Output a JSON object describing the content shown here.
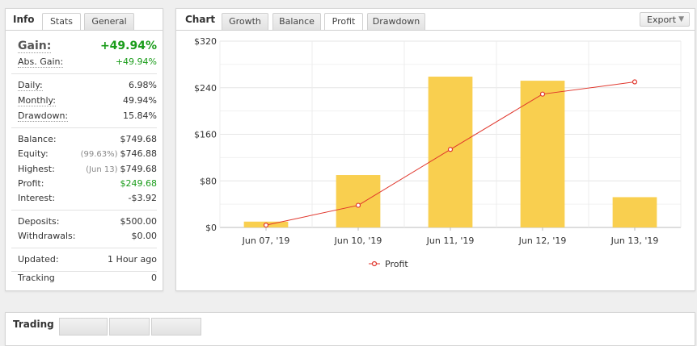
{
  "info_panel": {
    "tabs": [
      {
        "label": "Info"
      },
      {
        "label": "Stats"
      },
      {
        "label": "General"
      }
    ],
    "gain": {
      "label": "Gain:",
      "value": "+49.94%"
    },
    "abs_gain": {
      "label": "Abs. Gain:",
      "value": "+49.94%"
    },
    "daily": {
      "label": "Daily:",
      "value": "6.98%"
    },
    "monthly": {
      "label": "Monthly:",
      "value": "49.94%"
    },
    "drawdown": {
      "label": "Drawdown:",
      "value": "15.84%"
    },
    "balance": {
      "label": "Balance:",
      "value": "$749.68"
    },
    "equity": {
      "label": "Equity:",
      "note": "(99.63%)",
      "value": "$746.88"
    },
    "highest": {
      "label": "Highest:",
      "note": "(Jun 13)",
      "value": "$749.68"
    },
    "profit": {
      "label": "Profit:",
      "value": "$249.68"
    },
    "interest": {
      "label": "Interest:",
      "value": "-$3.92"
    },
    "deposits": {
      "label": "Deposits:",
      "value": "$500.00"
    },
    "withdrawals": {
      "label": "Withdrawals:",
      "value": "$0.00"
    },
    "updated": {
      "label": "Updated:",
      "value": "1 Hour ago"
    },
    "tracking": {
      "label": "Tracking",
      "value": "0"
    }
  },
  "chart_panel": {
    "title": "Chart",
    "tabs": [
      {
        "label": "Growth"
      },
      {
        "label": "Balance"
      },
      {
        "label": "Profit"
      },
      {
        "label": "Drawdown"
      }
    ],
    "active_tab": "Profit",
    "export_label": "Export",
    "legend_label": "Profit"
  },
  "bottom_panel": {
    "title": "Trading"
  },
  "colors": {
    "bar": "#f9cf4f",
    "line": "#e0362c",
    "gain_green": "#1a9c1a"
  },
  "chart_data": {
    "type": "bar",
    "categories": [
      "Jun 07, '19",
      "Jun 10, '19",
      "Jun 11, '19",
      "Jun 12, '19",
      "Jun 13, '19"
    ],
    "series": [
      {
        "name": "",
        "type": "bar",
        "values": [
          10,
          90,
          259,
          252,
          52
        ]
      },
      {
        "name": "Profit",
        "type": "line",
        "values": [
          4,
          38,
          134,
          229,
          250
        ]
      }
    ],
    "ylim": [
      0,
      320
    ],
    "yticks": [
      "$0",
      "$80",
      "$160",
      "$240",
      "$320"
    ],
    "grid": true,
    "legend": "bottom"
  }
}
